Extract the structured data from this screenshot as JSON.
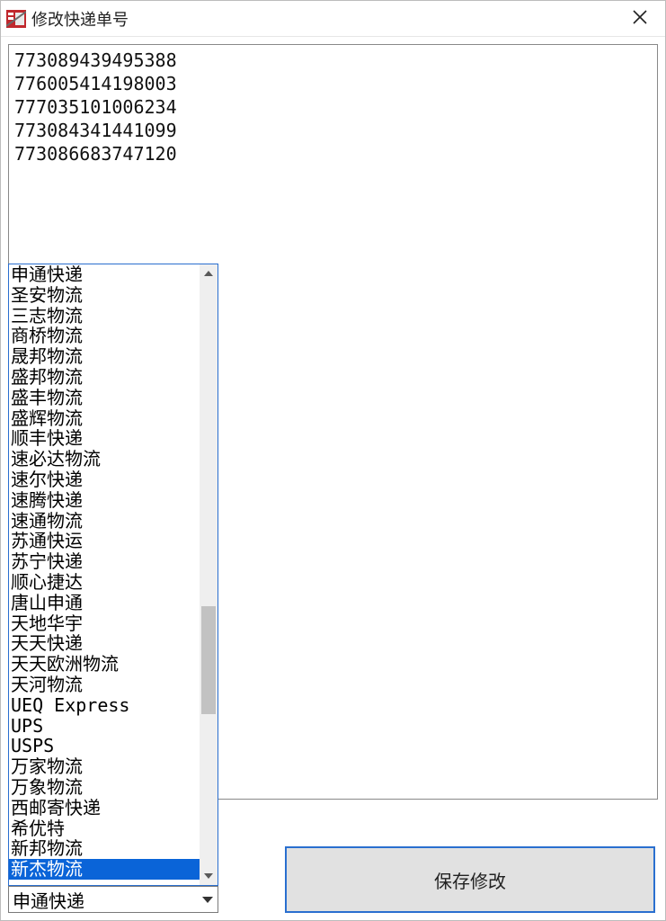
{
  "window": {
    "title": "修改快递单号",
    "icon": "app-icon"
  },
  "tracking_numbers": [
    "773089439495388",
    "776005414198003",
    "777035101006234",
    "773084341441099",
    "773086683747120"
  ],
  "courier_dropdown": {
    "selected_value": "申通快递",
    "highlighted_option": "新杰物流",
    "visible_options": [
      "申通快递",
      "圣安物流",
      "三志物流",
      "商桥物流",
      "晟邦物流",
      "盛邦物流",
      "盛丰物流",
      "盛辉物流",
      "顺丰快递",
      "速必达物流",
      "速尔快递",
      "速腾快递",
      "速通物流",
      "苏通快运",
      "苏宁快递",
      "顺心捷达",
      "唐山申通",
      "天地华宇",
      "天天快递",
      "天天欧洲物流",
      "天河物流",
      "UEQ Express",
      "UPS",
      "USPS",
      "万家物流",
      "万象物流",
      "西邮寄快递",
      "希优特",
      "新邦物流",
      "新杰物流"
    ]
  },
  "buttons": {
    "save_label": "保存修改"
  }
}
